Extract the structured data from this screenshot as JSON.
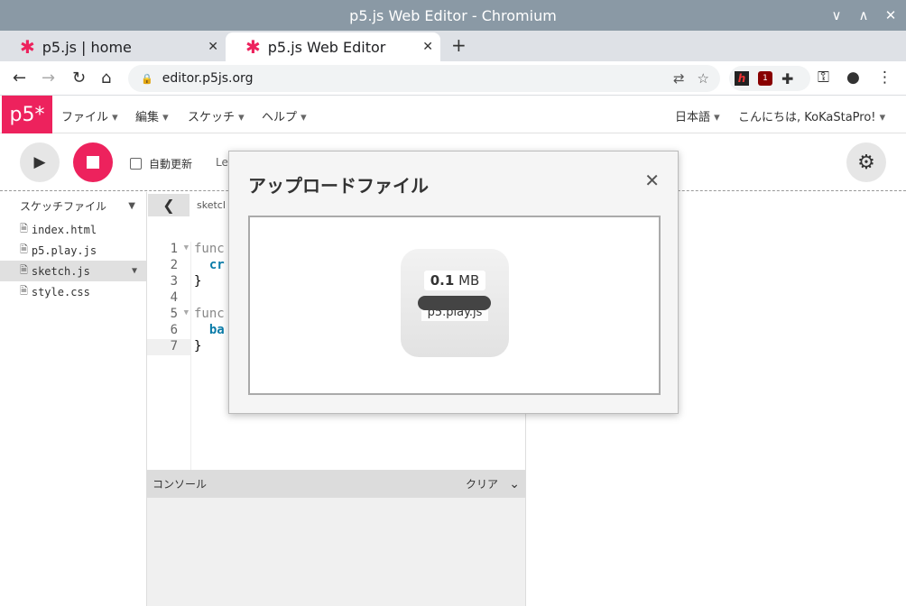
{
  "window": {
    "title": "p5.js Web Editor - Chromium"
  },
  "browser": {
    "tabs": [
      {
        "label": "p5.js | home"
      },
      {
        "label": "p5.js Web Editor"
      }
    ],
    "address": "editor.p5js.org",
    "ext_badge": "1"
  },
  "p5": {
    "logo": "p5*",
    "menu": [
      "ファイル",
      "編集",
      "スケッチ",
      "ヘルプ"
    ],
    "language": "日本語",
    "greeting": "こんにちは, KoKaStaPro!",
    "auto_refresh": "自動更新",
    "label_partial": "Le",
    "sidebar_header": "スケッチファイル",
    "files": [
      "index.html",
      "p5.play.js",
      "sketch.js",
      "style.css"
    ],
    "selected_file": "sketch.js",
    "editor_filename": "sketcl",
    "line_numbers": [
      "1",
      "2",
      "3",
      "4",
      "5",
      "6",
      "7"
    ],
    "code": {
      "l1": "func",
      "l2": "cr",
      "l3": "}",
      "l5": "func",
      "l6": "ba",
      "l7": "}"
    },
    "console_label": "コンソール",
    "console_clear": "クリア"
  },
  "modal": {
    "title": "アップロードファイル",
    "upload_size_value": "0.1",
    "upload_size_unit": "MB",
    "upload_filename": "p5.play.js"
  }
}
